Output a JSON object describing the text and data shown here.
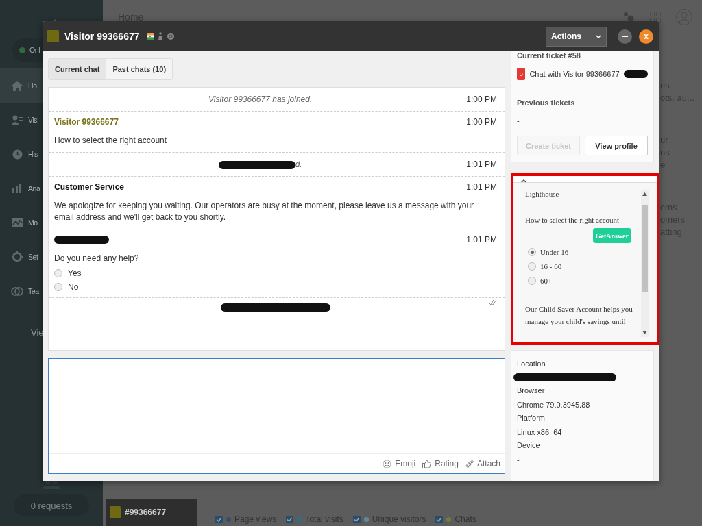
{
  "sidebar": {
    "status": "Onl",
    "items": [
      {
        "label": "Ho",
        "selected": true
      },
      {
        "label": "Visi",
        "selected": false
      },
      {
        "label": "His",
        "selected": false
      },
      {
        "label": "Ana",
        "selected": false
      },
      {
        "label": "Mo",
        "selected": false
      },
      {
        "label": "Set",
        "selected": false
      },
      {
        "label": "Tea",
        "selected": false
      }
    ],
    "sub_item": "Vie",
    "requests": "0 requests"
  },
  "topbar": {
    "title": "Home"
  },
  "side_fragments": [
    "es",
    "ots, au...",
    "ur",
    "ns",
    "e",
    "ems",
    "omers",
    "atting"
  ],
  "bottom_bar": {
    "chat_tab": "#99366677",
    "legend": [
      {
        "label": "Page views",
        "checked": true,
        "color": "#34506e"
      },
      {
        "label": "Total visits",
        "checked": true,
        "color": "#2f6d8c"
      },
      {
        "label": "Unique visitors",
        "checked": true,
        "color": "#5b8d96"
      },
      {
        "label": "Chats",
        "checked": true,
        "color": "#6f7f34"
      }
    ]
  },
  "chat_window": {
    "title": "Visitor 99366677",
    "actions": "Actions",
    "close_label": "x",
    "tabs": [
      {
        "label": "Current chat",
        "selected": true
      },
      {
        "label": "Past chats (10)",
        "selected": false
      }
    ],
    "messages": [
      {
        "kind": "system",
        "text": "Visitor 99366677 has joined.",
        "time": "1:00 PM"
      },
      {
        "kind": "visitor",
        "author": "Visitor 99366677",
        "time": "1:00 PM",
        "text": "How to select the right account"
      },
      {
        "kind": "system",
        "redacted": true,
        "text": "d.",
        "time": "1:01 PM"
      },
      {
        "kind": "agent",
        "author": "Customer Service",
        "time": "1:01 PM",
        "text": "We apologize for keeping you waiting. Our operators are busy at the moment, please leave us a message with your email address and we'll get back to you shortly."
      },
      {
        "kind": "agent",
        "redacted": true,
        "time": "1:01 PM",
        "text": "Do you need any help?",
        "options": [
          {
            "label": "Yes",
            "selected": false
          },
          {
            "label": "No",
            "selected": false
          }
        ]
      },
      {
        "kind": "system",
        "redacted": true,
        "read": true
      }
    ],
    "composer": {
      "tools": [
        {
          "label": "Emoji"
        },
        {
          "label": "Rating"
        },
        {
          "label": "Attach"
        }
      ]
    },
    "ticket": {
      "heading": "Current ticket  #58",
      "badge": "o",
      "title": "Chat with Visitor 99366677",
      "previous_heading": "Previous tickets",
      "previous_value": "-",
      "buttons": [
        {
          "label": "Create ticket",
          "disabled": true
        },
        {
          "label": "View profile",
          "disabled": false
        }
      ]
    },
    "widget": {
      "title": "Lighthouse",
      "question": "How to select the right account",
      "button": "GetAnswer",
      "options": [
        {
          "label": "Under 16",
          "selected": true
        },
        {
          "label": "16 - 60",
          "selected": false
        },
        {
          "label": "60+",
          "selected": false
        }
      ],
      "answer": "Our Child Saver Account helps you manage your child's savings until"
    },
    "details": [
      {
        "label": "Location",
        "redacted": true
      },
      {
        "label": "Browser",
        "value": "Chrome 79.0.3945.88"
      },
      {
        "label": "Platform",
        "value": "Linux x86_64"
      },
      {
        "label": "Device",
        "value": "-"
      }
    ]
  }
}
